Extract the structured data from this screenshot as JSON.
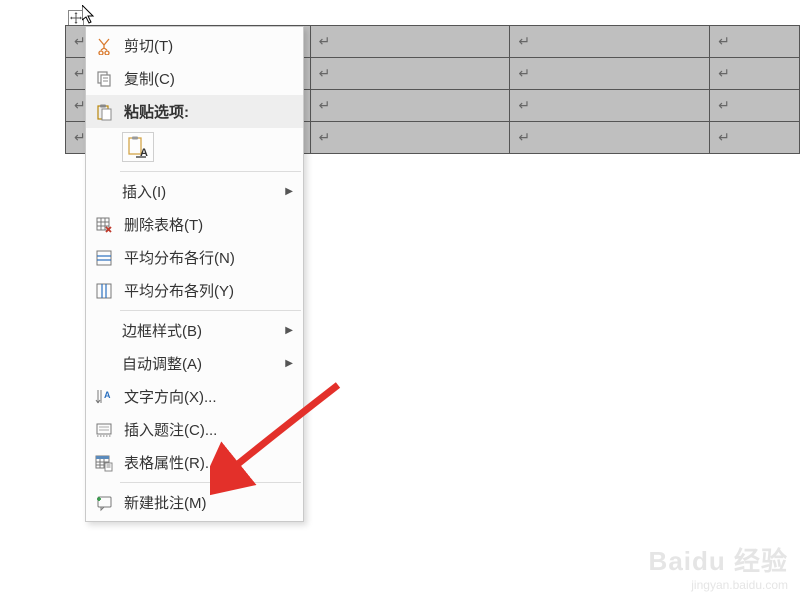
{
  "table": {
    "rows": 4,
    "cols": 4,
    "return_symbol": "↵"
  },
  "menu": {
    "cut": "剪切(T)",
    "copy": "复制(C)",
    "paste_options": "粘贴选项:",
    "paste_text_only": "A",
    "insert": "插入(I)",
    "delete_table": "删除表格(T)",
    "distribute_rows": "平均分布各行(N)",
    "distribute_cols": "平均分布各列(Y)",
    "border_styles": "边框样式(B)",
    "autofit": "自动调整(A)",
    "text_direction": "文字方向(X)...",
    "insert_caption": "插入题注(C)...",
    "table_properties": "表格属性(R)...",
    "new_comment": "新建批注(M)"
  },
  "watermark": {
    "main": "Baidu 经验",
    "sub": "jingyan.baidu.com"
  }
}
